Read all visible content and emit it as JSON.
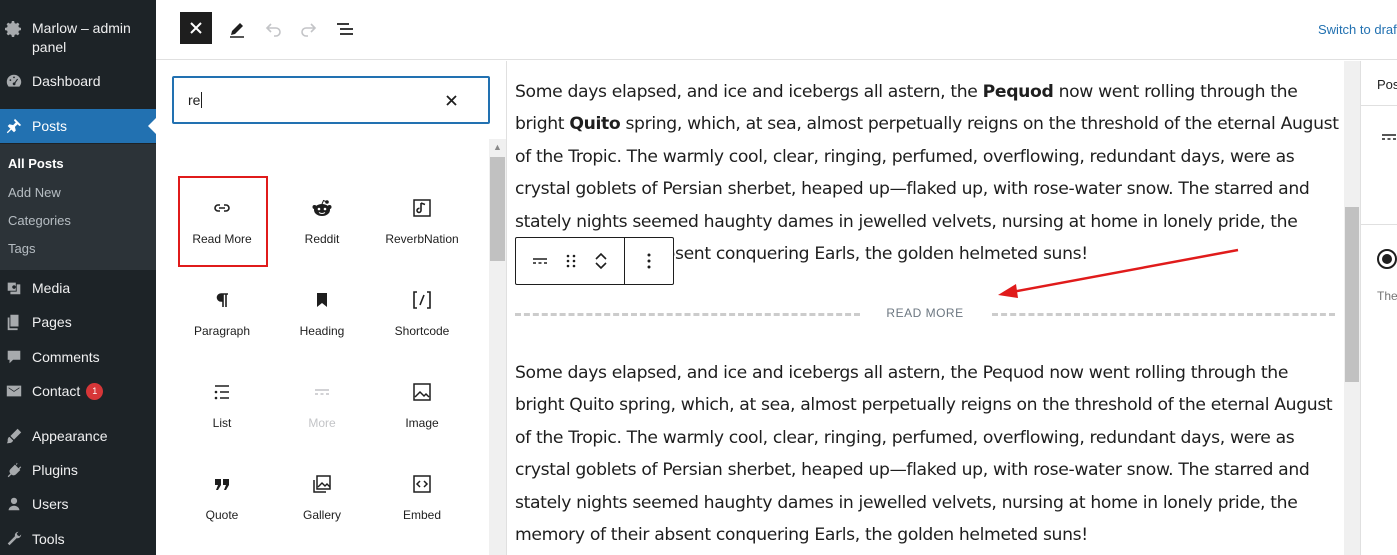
{
  "admin": {
    "site_name": "Marlow – admin panel",
    "menu": [
      {
        "label": "Dashboard",
        "icon": "dashboard-icon"
      },
      {
        "label": "Posts",
        "icon": "pin-icon"
      },
      {
        "label": "Media",
        "icon": "media-icon"
      },
      {
        "label": "Pages",
        "icon": "pages-icon"
      },
      {
        "label": "Comments",
        "icon": "comments-icon"
      },
      {
        "label": "Contact",
        "icon": "mail-icon",
        "badge": "1"
      },
      {
        "label": "Appearance",
        "icon": "appearance-icon"
      },
      {
        "label": "Plugins",
        "icon": "plugins-icon"
      },
      {
        "label": "Users",
        "icon": "users-icon"
      },
      {
        "label": "Tools",
        "icon": "tools-icon"
      }
    ],
    "submenu": [
      "All Posts",
      "Add New",
      "Categories",
      "Tags"
    ]
  },
  "header": {
    "switch_draft": "Switch to draft"
  },
  "inserter": {
    "search_value": "re",
    "blocks": [
      {
        "label": "Read More",
        "icon": "link-icon",
        "highlighted": true
      },
      {
        "label": "Reddit",
        "icon": "reddit-icon"
      },
      {
        "label": "ReverbNation",
        "icon": "music-note-icon"
      },
      {
        "label": "Paragraph",
        "icon": "paragraph-icon"
      },
      {
        "label": "Heading",
        "icon": "bookmark-icon"
      },
      {
        "label": "Shortcode",
        "icon": "shortcode-icon"
      },
      {
        "label": "List",
        "icon": "list-icon"
      },
      {
        "label": "More",
        "icon": "more-icon",
        "disabled": true
      },
      {
        "label": "Image",
        "icon": "image-icon"
      },
      {
        "label": "Quote",
        "icon": "quote-icon"
      },
      {
        "label": "Gallery",
        "icon": "gallery-icon"
      },
      {
        "label": "Embed",
        "icon": "embed-icon"
      }
    ]
  },
  "content": {
    "para1": {
      "a": "Some days elapsed, and ice and icebergs all astern, the ",
      "b1": "Pequod",
      "c": " now went rolling through the bright ",
      "b2": "Quito",
      "d": " spring, which, at sea, almost perpetually reigns on the threshold of the eternal August of the Tropic. The warmly cool, clear, ringing, perfumed, overflowing, redundant days, were as crystal goblets of Persian sherbet, heaped up—flaked up, with rose-water snow. The starred and stately nights seemed haughty dames in jewelled velvets, nursing at home in lonely pride, the memory of their absent conquering Earls, the golden helmeted suns!"
    },
    "read_more_label": "READ MORE",
    "para2": "Some days elapsed, and ice and icebergs all astern, the Pequod now went rolling through the bright Quito spring, which, at sea, almost perpetually reigns on the threshold of the eternal August of the Tropic. The warmly cool, clear, ringing, perfumed, overflowing, redundant days, were as crystal goblets of Persian sherbet, heaped up—flaked up, with rose-water snow. The starred and stately nights seemed haughty dames in jewelled velvets, nursing at home in lonely pride, the memory of their absent conquering Earls, the golden helmeted suns!"
  },
  "settings": {
    "tab": "Post",
    "text": "The"
  },
  "colors": {
    "admin_bg": "#1d2327",
    "accent": "#2271b1",
    "highlight": "#e01b1b",
    "badge": "#d63638"
  }
}
